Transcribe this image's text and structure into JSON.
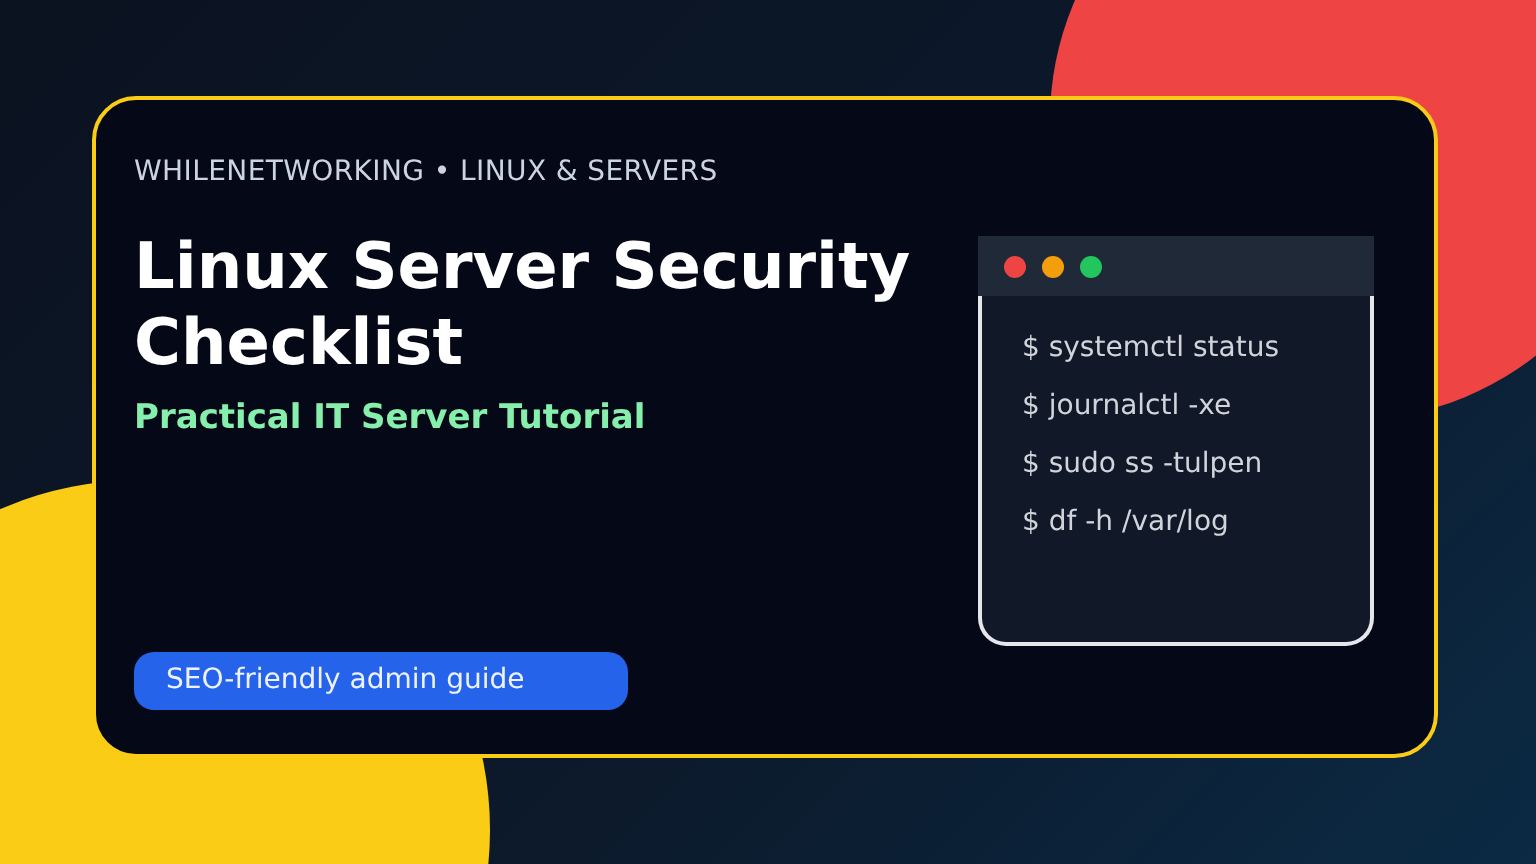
{
  "eyebrow": "WHILENETWORKING • LINUX & SERVERS",
  "title": "Linux Server Security Checklist",
  "subtitle": "Practical IT Server Tutorial",
  "badge": "SEO-friendly admin guide",
  "terminal": {
    "dots": [
      {
        "color": "#ef4444"
      },
      {
        "color": "#f59e0b"
      },
      {
        "color": "#22c55e"
      }
    ],
    "lines": [
      "$ systemctl status",
      "$ journalctl -xe",
      "$ sudo ss -tulpen",
      "$ df -h /var/log"
    ]
  }
}
